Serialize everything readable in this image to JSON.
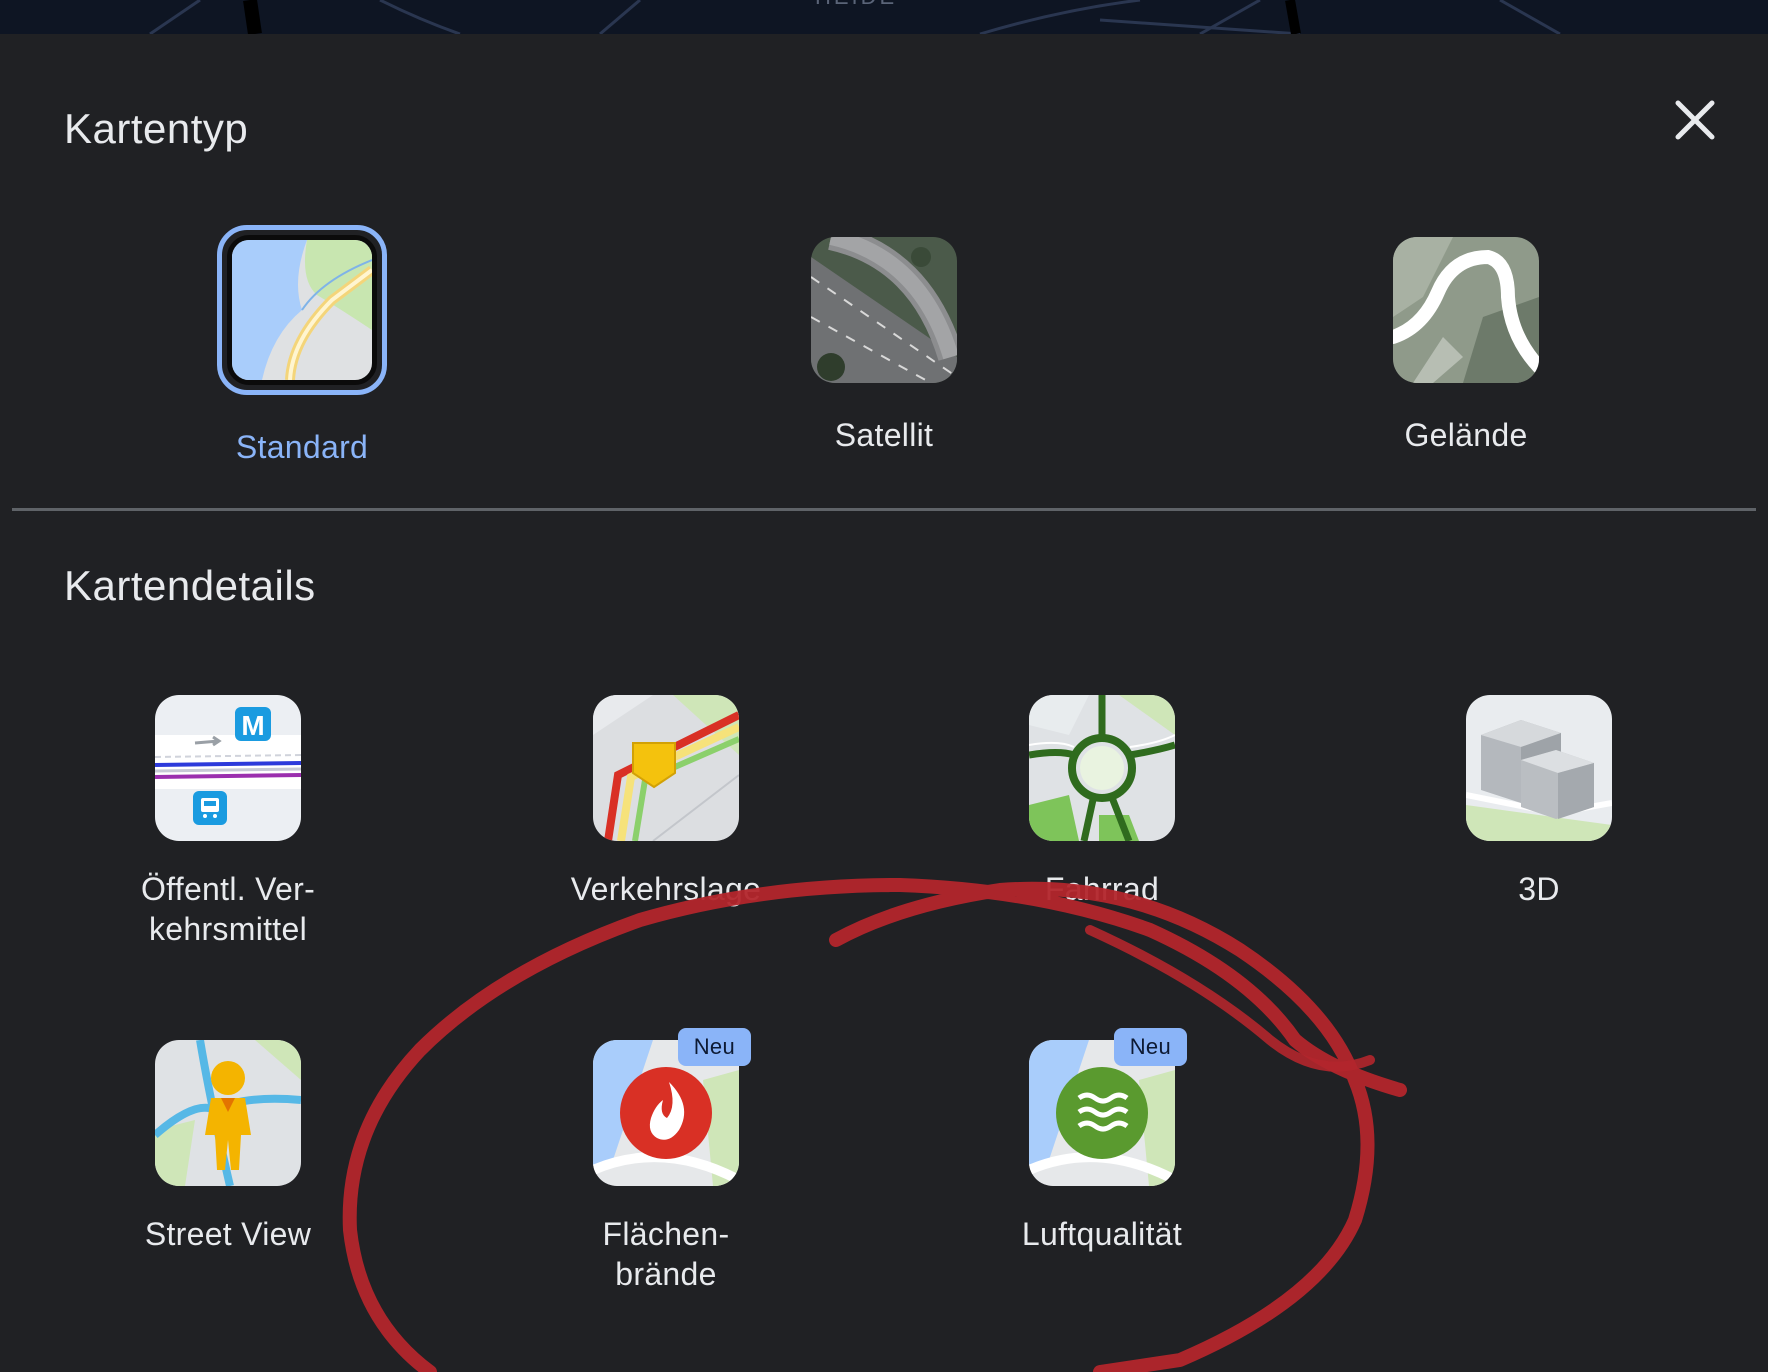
{
  "map_strip": {
    "label": "HEIDE"
  },
  "map_type": {
    "title": "Kartentyp",
    "items": [
      {
        "label": "Standard",
        "selected": true
      },
      {
        "label": "Satellit",
        "selected": false
      },
      {
        "label": "Gelände",
        "selected": false
      }
    ]
  },
  "map_details": {
    "title": "Kartendetails",
    "items": [
      {
        "label_line1": "Öffentl. Ver-",
        "label_line2": "kehrsmittel"
      },
      {
        "label_line1": "Verkehrslage",
        "label_line2": ""
      },
      {
        "label_line1": "Fahrrad",
        "label_line2": ""
      },
      {
        "label_line1": "3D",
        "label_line2": ""
      },
      {
        "label_line1": "Street View",
        "label_line2": ""
      },
      {
        "label_line1": "Flächen-",
        "label_line2": "brände",
        "badge": "Neu"
      },
      {
        "label_line1": "Luftqualität",
        "label_line2": "",
        "badge": "Neu"
      }
    ]
  },
  "colors": {
    "background": "#202124",
    "text": "#e8eaed",
    "accent": "#8ab4f8",
    "scribble": "#b3262c"
  },
  "icons": {
    "close": "close-icon",
    "standard": "standard-map-icon",
    "satellite": "satellite-map-icon",
    "terrain": "terrain-map-icon",
    "transit": "transit-icon",
    "traffic": "traffic-icon",
    "bicycle": "bicycle-icon",
    "three_d": "3d-buildings-icon",
    "street_view": "street-view-pegman-icon",
    "wildfires": "wildfire-icon",
    "air_quality": "air-quality-icon"
  }
}
